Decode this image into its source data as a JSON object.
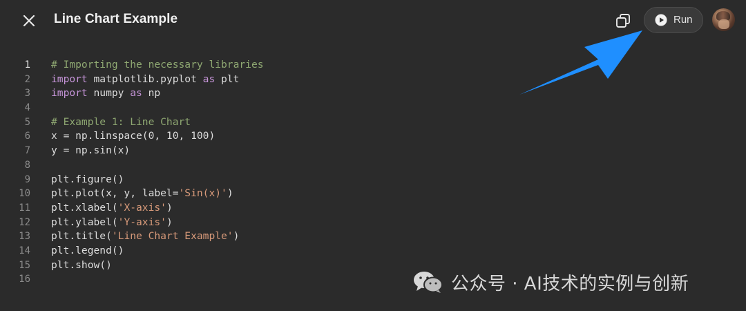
{
  "header": {
    "title": "Line Chart Example",
    "run_label": "Run"
  },
  "icons": {
    "close": "close-icon",
    "copy": "copy-icon",
    "run": "play-circle-icon",
    "avatar": "user-avatar",
    "arrow": "annotation-arrow-icon",
    "watermark": "wechat-icon"
  },
  "colors": {
    "background": "#2b2b2b",
    "arrow": "#1f8fff",
    "comment": "#8fa872",
    "keyword": "#c594d8",
    "string": "#d89a7a",
    "text": "#dcdcdc"
  },
  "editor": {
    "active_line": 1,
    "lines": [
      {
        "number": "1",
        "tokens": [
          {
            "t": "# Importing the necessary libraries",
            "k": "comment"
          }
        ]
      },
      {
        "number": "2",
        "tokens": [
          {
            "t": "import",
            "k": "keyword"
          },
          {
            "t": " matplotlib.pyplot ",
            "k": "text"
          },
          {
            "t": "as",
            "k": "keyword"
          },
          {
            "t": " plt",
            "k": "text"
          }
        ]
      },
      {
        "number": "3",
        "tokens": [
          {
            "t": "import",
            "k": "keyword"
          },
          {
            "t": " numpy ",
            "k": "text"
          },
          {
            "t": "as",
            "k": "keyword"
          },
          {
            "t": " np",
            "k": "text"
          }
        ]
      },
      {
        "number": "4",
        "tokens": []
      },
      {
        "number": "5",
        "tokens": [
          {
            "t": "# Example 1: Line Chart",
            "k": "comment"
          }
        ]
      },
      {
        "number": "6",
        "tokens": [
          {
            "t": "x = np.linspace(0, 10, 100)",
            "k": "text"
          }
        ]
      },
      {
        "number": "7",
        "tokens": [
          {
            "t": "y = np.sin(x)",
            "k": "text"
          }
        ]
      },
      {
        "number": "8",
        "tokens": []
      },
      {
        "number": "9",
        "tokens": [
          {
            "t": "plt.figure()",
            "k": "text"
          }
        ]
      },
      {
        "number": "10",
        "tokens": [
          {
            "t": "plt.plot(x, y, label=",
            "k": "text"
          },
          {
            "t": "'Sin(x)'",
            "k": "string"
          },
          {
            "t": ")",
            "k": "text"
          }
        ]
      },
      {
        "number": "11",
        "tokens": [
          {
            "t": "plt.xlabel(",
            "k": "text"
          },
          {
            "t": "'X-axis'",
            "k": "string"
          },
          {
            "t": ")",
            "k": "text"
          }
        ]
      },
      {
        "number": "12",
        "tokens": [
          {
            "t": "plt.ylabel(",
            "k": "text"
          },
          {
            "t": "'Y-axis'",
            "k": "string"
          },
          {
            "t": ")",
            "k": "text"
          }
        ]
      },
      {
        "number": "13",
        "tokens": [
          {
            "t": "plt.title(",
            "k": "text"
          },
          {
            "t": "'Line Chart Example'",
            "k": "string"
          },
          {
            "t": ")",
            "k": "text"
          }
        ]
      },
      {
        "number": "14",
        "tokens": [
          {
            "t": "plt.legend()",
            "k": "text"
          }
        ]
      },
      {
        "number": "15",
        "tokens": [
          {
            "t": "plt.show()",
            "k": "text"
          }
        ]
      },
      {
        "number": "16",
        "tokens": []
      }
    ]
  },
  "watermark": {
    "text": "公众号 · AI技术的实例与创新"
  }
}
